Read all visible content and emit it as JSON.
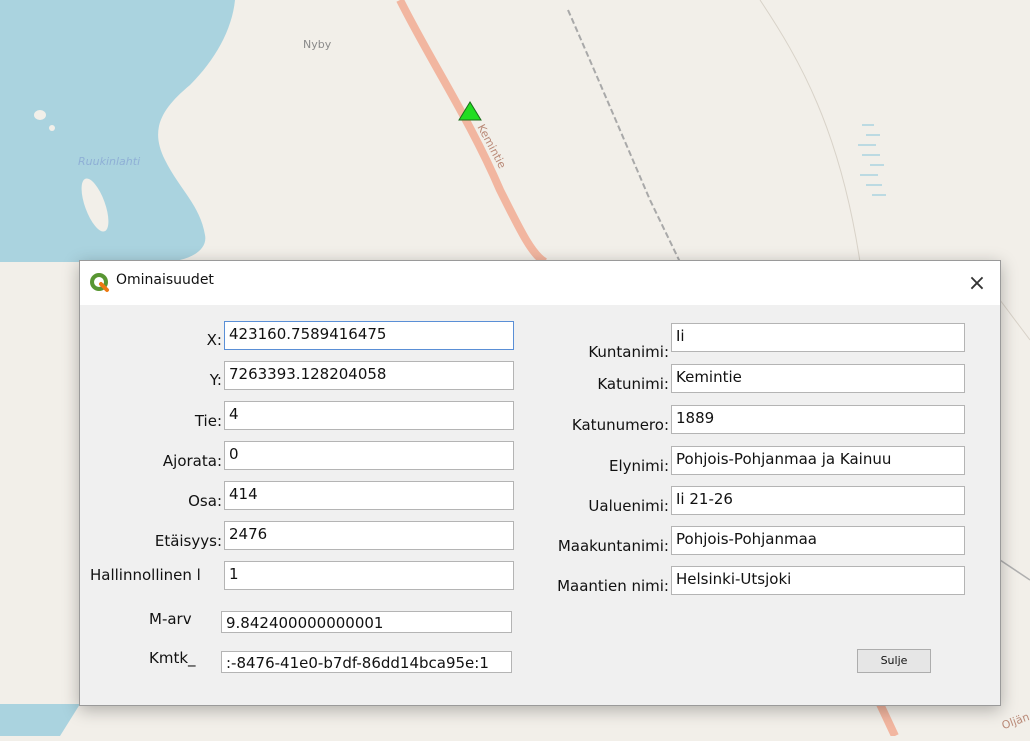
{
  "map": {
    "labels": {
      "nyby": "Nyby",
      "ruukinlahti": "Ruukinlahti",
      "kemintie": "Kemintie",
      "oljan": "Oljän"
    },
    "marker": {
      "shape": "triangle",
      "color": "#22dd22"
    },
    "colors": {
      "land": "#f2efe9",
      "water": "#aad3df",
      "road": "#f2b6a0"
    }
  },
  "dialog": {
    "title": "Ominaisuudet",
    "icon": "qgis-logo-icon",
    "close_glyph": "×",
    "left_fields": [
      {
        "label": "X:",
        "value": "423160.7589416475"
      },
      {
        "label": "Y:",
        "value": "7263393.128204058"
      },
      {
        "label": "Tie:",
        "value": "4"
      },
      {
        "label": "Ajorata:",
        "value": "0"
      },
      {
        "label": "Osa:",
        "value": "414"
      },
      {
        "label": "Etäisyys:",
        "value": "2476"
      },
      {
        "label": "Hallinnollinen l",
        "value": "1"
      },
      {
        "label": "M-arv",
        "value": "9.842400000000001"
      },
      {
        "label": "Kmtk_",
        "value": ":-8476-41e0-b7df-86dd14bca95e:1"
      }
    ],
    "right_fields": [
      {
        "label": "Kuntanimi:",
        "value": "Ii"
      },
      {
        "label": "Katunimi:",
        "value": "Kemintie"
      },
      {
        "label": "Katunumero:",
        "value": "1889"
      },
      {
        "label": "Elynimi:",
        "value": "Pohjois-Pohjanmaa ja Kainuu"
      },
      {
        "label": "Ualuenimi:",
        "value": "Ii 21-26"
      },
      {
        "label": "Maakuntanimi:",
        "value": "Pohjois-Pohjanmaa"
      },
      {
        "label": "Maantien nimi:",
        "value": "Helsinki-Utsjoki"
      }
    ],
    "close_button_label": "Sulje"
  }
}
